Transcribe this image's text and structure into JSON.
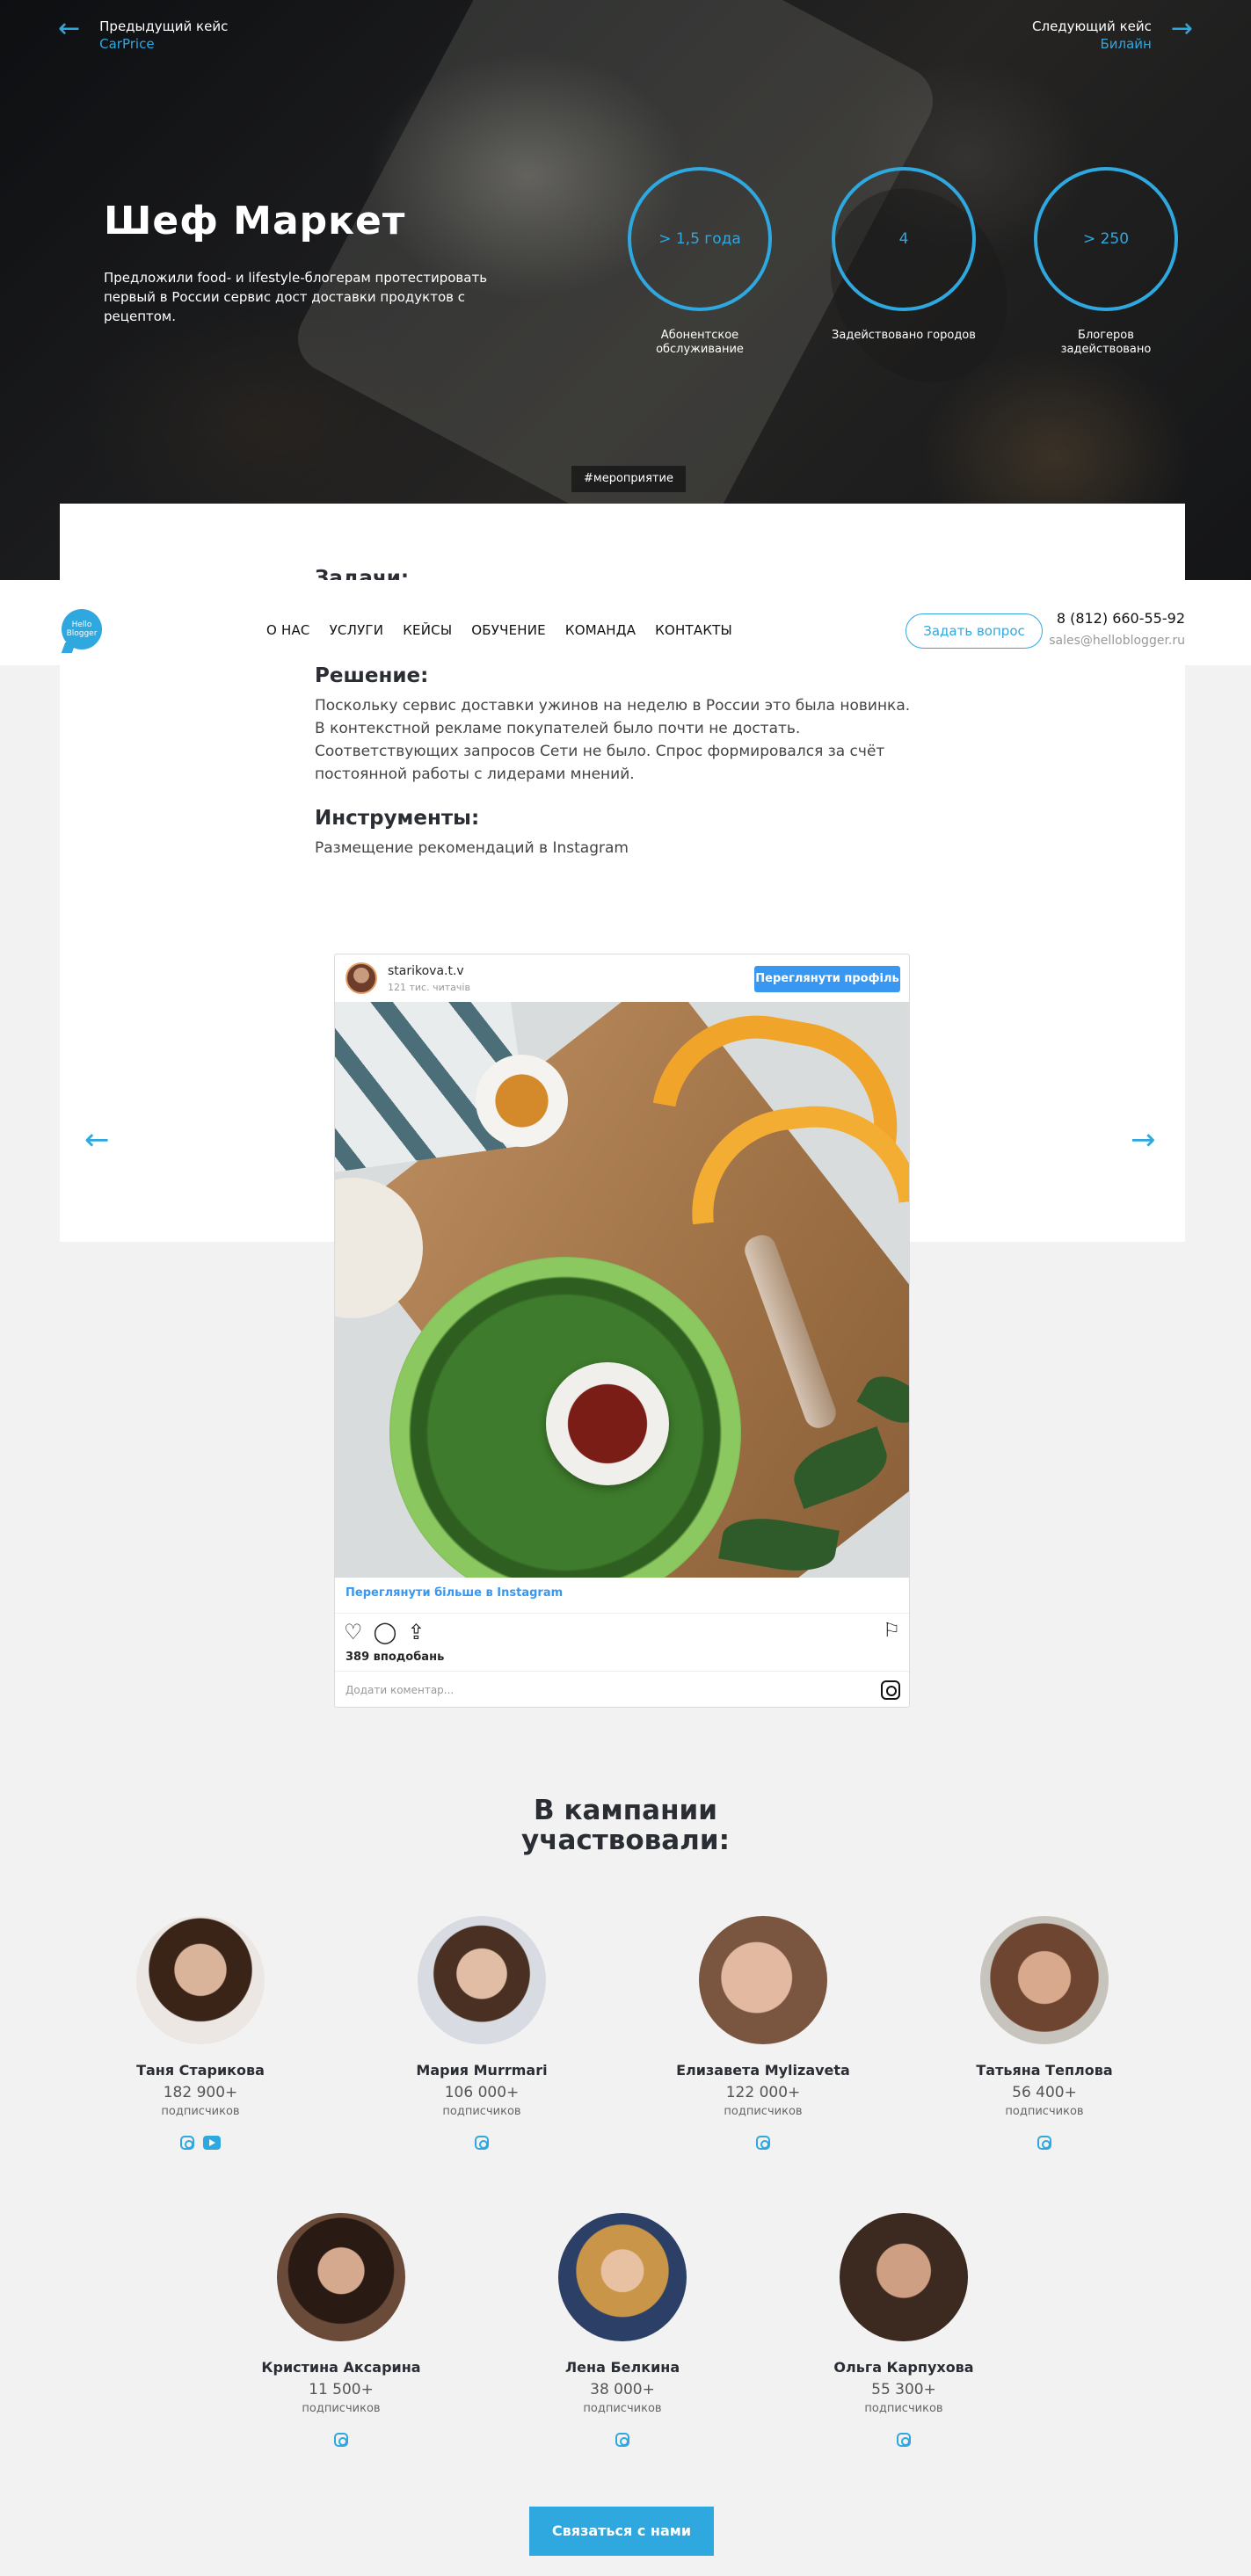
{
  "case_nav": {
    "prev_label": "Предыдущий кейс",
    "prev_name": "CarPrice",
    "next_label": "Следующий кейс",
    "next_name": "Билайн"
  },
  "hero": {
    "title": "Шеф Маркет",
    "description": "Предложили food- и lifestyle-блогерам протестировать первый в России сервис дост доставки продуктов с рецептом.",
    "tag": "#мероприятие",
    "stats": [
      {
        "value": "> 1,5 года",
        "caption": "Абонентское обслуживание"
      },
      {
        "value": "4",
        "caption": "Задействовано городов"
      },
      {
        "value": "> 250",
        "caption": "Блогеров задействовано"
      }
    ]
  },
  "header": {
    "logo_text": "Hello Blogger",
    "menu": [
      "О НАС",
      "УСЛУГИ",
      "КЕЙСЫ",
      "ОБУЧЕНИЕ",
      "КОМАНДА",
      "КОНТАКТЫ"
    ],
    "ask_button": "Задать вопрос",
    "phone": "8 (812) 660-55-92",
    "email": "sales@helloblogger.ru"
  },
  "content": {
    "tasks_title": "Задачи:",
    "solution_title": "Решение:",
    "solution_text": "Поскольку сервис доставки ужинов на неделю в России это была новинка. В контекстной рекламе покупателей было почти не достать. Соответствующих запросов Сети не было. Спрос формировался за счёт постоянной работы с лидерами мнений.",
    "tools_title": "Инструменты:",
    "tools_text": "Размещение рекомендаций в Instagram"
  },
  "instagram": {
    "username": "starikova.t.v",
    "followers": "121 тис. читачів",
    "follow_button": "Переглянути профіль",
    "more_link": "Переглянути більше в Instagram",
    "likes": "389 вподобань",
    "comment_placeholder": "Додати коментар..."
  },
  "participants": {
    "title_line1": "В кампании",
    "title_line2": "участвовали:",
    "followers_label": "подписчиков",
    "people": [
      {
        "name": "Таня Старикова",
        "count": "182 900+",
        "youtube": true
      },
      {
        "name": "Мария Murrmari",
        "count": "106 000+",
        "youtube": false
      },
      {
        "name": "Елизавета Mylizaveta",
        "count": "122 000+",
        "youtube": false
      },
      {
        "name": "Татьяна Теплова",
        "count": "56 400+",
        "youtube": false
      },
      {
        "name": "Кристина Аксарина",
        "count": "11 500+",
        "youtube": false
      },
      {
        "name": "Лена Белкина",
        "count": "38 000+",
        "youtube": false
      },
      {
        "name": "Ольга Карпухова",
        "count": "55 300+",
        "youtube": false
      }
    ]
  },
  "contact_button": "Связаться с нами",
  "colors": {
    "accent": "#2fa8e0",
    "instagram_blue": "#3897f0"
  }
}
